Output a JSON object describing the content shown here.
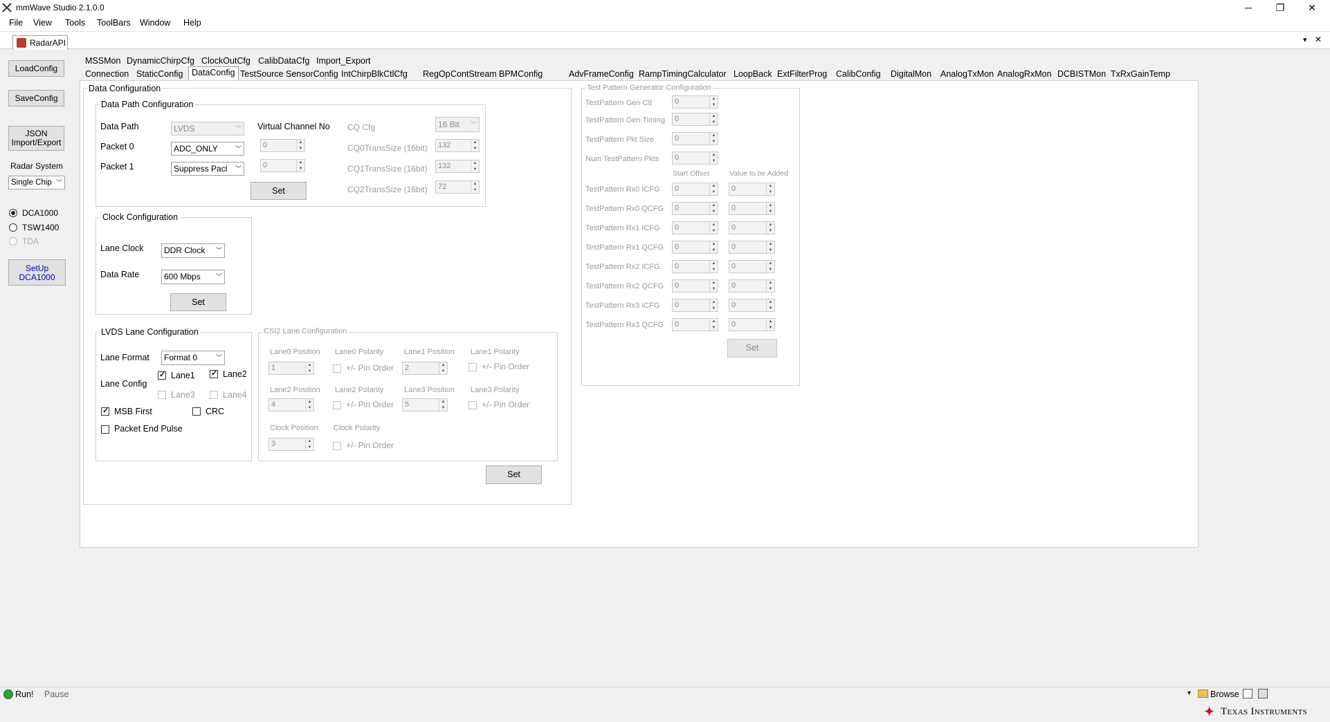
{
  "window": {
    "title": "mmWave Studio 2.1.0.0",
    "minimize": "─",
    "restore": "❐",
    "close": "✕"
  },
  "menu": [
    "File",
    "View",
    "Tools",
    "ToolBars",
    "Window",
    "Help"
  ],
  "doc_tab": {
    "label": "RadarAPI",
    "pin": "▾",
    "close": "✕"
  },
  "left_panel": {
    "load_config": "LoadConfig",
    "save_config": "SaveConfig",
    "json_line1": "JSON",
    "json_line2": "Import/Export",
    "radar_system_label": "Radar System",
    "radar_system_value": "Single Chip",
    "capture": [
      {
        "label": "DCA1000",
        "selected": true,
        "enabled": true
      },
      {
        "label": "TSW1400",
        "selected": false,
        "enabled": true
      },
      {
        "label": "TDA",
        "selected": false,
        "enabled": false
      }
    ],
    "setup_line1": "SetUp",
    "setup_line2": "DCA1000"
  },
  "tabs_row1": [
    "MSSMon",
    "DynamicChirpCfg",
    "ClockOutCfg",
    "CalibDataCfg",
    "Import_Export"
  ],
  "tabs_row2": [
    "Connection",
    "StaticConfig",
    "DataConfig",
    "TestSource",
    "SensorConfig",
    "IntChirpBlkCtlCfg",
    "RegOp",
    "ContStream",
    "BPMConfig",
    "AdvFrameConfig",
    "RampTimingCalculator",
    "LoopBack",
    "ExtFilterProg",
    "CalibConfig",
    "DigitalMon",
    "AnalogTxMon",
    "AnalogRxMon",
    "DCBISTMon",
    "TxRxGainTemp"
  ],
  "active_tab": "DataConfig",
  "data_config": {
    "title": "Data Configuration",
    "data_path": {
      "title": "Data Path Configuration",
      "data_path_label": "Data Path",
      "data_path_value": "LVDS",
      "packet0_label": "Packet 0",
      "packet0_value": "ADC_ONLY",
      "packet1_label": "Packet 1",
      "packet1_value": "Suppress Pacl",
      "vc_label": "Virtual Channel No",
      "vc0": "0",
      "vc1": "0",
      "set": "Set",
      "cq_cfg_label": "CQ Cfg",
      "cq_cfg_value": "16 Bit",
      "cq0_label": "CQ0TransSize (16bit)",
      "cq0_value": "132",
      "cq1_label": "CQ1TransSize (16bit)",
      "cq1_value": "132",
      "cq2_label": "CQ2TransSize (16bit)",
      "cq2_value": "72"
    },
    "clock": {
      "title": "Clock Configuration",
      "lane_clock_label": "Lane Clock",
      "lane_clock_value": "DDR Clock",
      "data_rate_label": "Data Rate",
      "data_rate_value": "600 Mbps",
      "set": "Set"
    },
    "lvds": {
      "title": "LVDS Lane Configuration",
      "lane_format_label": "Lane Format",
      "lane_format_value": "Format 0",
      "lane_config_label": "Lane Config",
      "lane1": "Lane1",
      "lane2": "Lane2",
      "lane3": "Lane3",
      "lane4": "Lane4",
      "msb_first": "MSB First",
      "crc": "CRC",
      "packet_end_pulse": "Packet End Pulse"
    },
    "csi2": {
      "title": "CSI2 Lane Configuration",
      "lane0_pos_label": "Lane0 Position",
      "lane0_pos": "1",
      "lane0_pol_label": "Lane0 Polarity",
      "lane1_pos_label": "Lane1 Position",
      "lane1_pos": "2",
      "lane1_pol_label": "Lane1 Polarity",
      "lane2_pos_label": "Lane2 Position",
      "lane2_pos": "4",
      "lane2_pol_label": "Lane2 Polarity",
      "lane3_pos_label": "Lane3 Position",
      "lane3_pos": "5",
      "lane3_pol_label": "Lane3 Polarity",
      "clock_pos_label": "Clock Position",
      "clock_pos": "3",
      "clock_pol_label": "Clock Polarity",
      "pin_order": "+/- Pin Order"
    },
    "set": "Set"
  },
  "test_pattern": {
    "title": "Test Pattern Generator Configuration",
    "gen_ctl_label": "TestPattern Gen Ctl",
    "gen_ctl": "0",
    "gen_timing_label": "TestPattern Gen Timing",
    "gen_timing": "0",
    "pkt_size_label": "TestPattern Pkt Size",
    "pkt_size": "0",
    "num_pkts_label": "Num TestPattern Pkts",
    "num_pkts": "0",
    "start_offset_label": "Start Offset",
    "value_added_label": "Value to be Added",
    "rows": [
      {
        "label": "TestPattern Rx0 ICFG",
        "offset": "0",
        "value": "0"
      },
      {
        "label": "TestPattern Rx0 QCFG",
        "offset": "0",
        "value": "0"
      },
      {
        "label": "TestPattern Rx1 ICFG",
        "offset": "0",
        "value": "0"
      },
      {
        "label": "TestPattern Rx1 QCFG",
        "offset": "0",
        "value": "0"
      },
      {
        "label": "TestPattern Rx2 ICFG",
        "offset": "0",
        "value": "0"
      },
      {
        "label": "TestPattern Rx2 QCFG",
        "offset": "0",
        "value": "0"
      },
      {
        "label": "TestPattern Rx3 ICFG",
        "offset": "0",
        "value": "0"
      },
      {
        "label": "TestPattern Rx3 QCFG",
        "offset": "0",
        "value": "0"
      }
    ],
    "set": "Set"
  },
  "status": {
    "run": "Run!",
    "pause": "Pause",
    "browse": "Browse",
    "brand": "Texas Instruments"
  },
  "colors": {
    "ti_red": "#c8102e",
    "run_green": "#2e9e3e",
    "link_blue": "#0000cc"
  }
}
